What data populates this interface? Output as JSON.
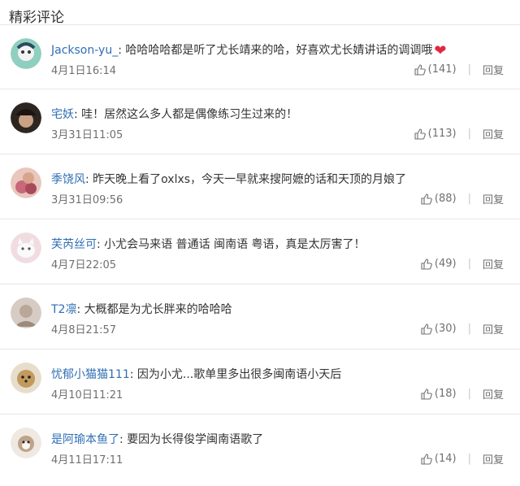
{
  "section": {
    "title": "精彩评论"
  },
  "comments": [
    {
      "user": "Jackson-yu_",
      "text": "哈哈哈哈都是听了尤长靖来的哈，好喜欢尤长婧讲话的调调哦",
      "time": "4月1日16:14",
      "likes": "(141)",
      "reply": "回复",
      "emoji": "❤",
      "avatar_color": "#8fcfbf"
    },
    {
      "user": "宅妖",
      "text": "哇！居然这么多人都是偶像练习生过来的！",
      "time": "3月31日11:05",
      "likes": "(113)",
      "reply": "回复",
      "avatar_color": "#2d2620"
    },
    {
      "user": "季饶风",
      "text": "昨天晚上看了oxlxs，今天一早就来搜阿嬷的话和天顶的月娘了",
      "time": "3月31日09:56",
      "likes": "(88)",
      "reply": "回复",
      "avatar_color": "#c9687a"
    },
    {
      "user": "芙芮丝可",
      "text": "小尤会马来语 普通话 闽南语 粤语，真是太厉害了！",
      "time": "4月7日22:05",
      "likes": "(49)",
      "reply": "回复",
      "avatar_color": "#e8b9c0"
    },
    {
      "user": "T2凛",
      "text": "大概都是为尤长胖来的哈哈哈",
      "time": "4月8日21:57",
      "likes": "(30)",
      "reply": "回复",
      "avatar_color": "#b9a89a"
    },
    {
      "user": "忧郁小猫猫111",
      "text": "因为小尤...歌单里多出很多闽南语小天后",
      "time": "4月10日11:21",
      "likes": "(18)",
      "reply": "回复",
      "avatar_color": "#c29a5e"
    },
    {
      "user": "是阿瑜本鱼了",
      "text": "要因为长得俊学闽南语歌了",
      "time": "4月11日17:11",
      "likes": "(14)",
      "reply": "回复",
      "avatar_color": "#bda48a"
    }
  ]
}
